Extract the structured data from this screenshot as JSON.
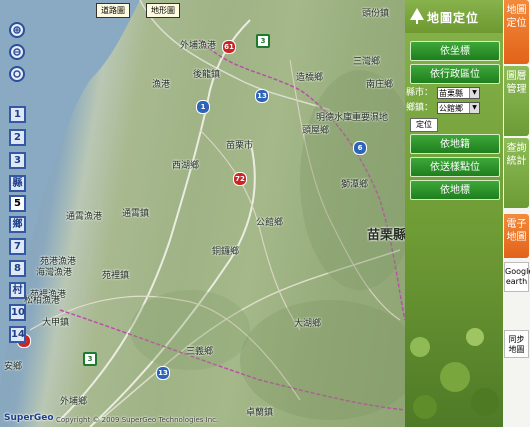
{
  "map": {
    "buttons": {
      "road_map": "道路圖",
      "terrain_map": "地形圖"
    },
    "zoom_levels": [
      "1",
      "2",
      "3",
      "縣",
      "5",
      "鄉",
      "7",
      "8",
      "村",
      "10",
      "14"
    ],
    "current_level": "5",
    "copyright": "Copyright © 2009 SuperGeo Technologies Inc.",
    "logo": "SuperGeo",
    "labels": [
      {
        "text": "頭份鎮"
      },
      {
        "text": "外埔漁港"
      },
      {
        "text": "後龍鎮"
      },
      {
        "text": "三灣鄉"
      },
      {
        "text": "造橋鄉"
      },
      {
        "text": "南庄鄉"
      },
      {
        "text": "苗栗市"
      },
      {
        "text": "頭屋鄉"
      },
      {
        "text": "明德水庫重要濕地"
      },
      {
        "text": "獅潭鄉"
      },
      {
        "text": "西湖鄉"
      },
      {
        "text": "通霄漁港"
      },
      {
        "text": "通霄鎮"
      },
      {
        "text": "公館鄉"
      },
      {
        "text": "苗栗縣"
      },
      {
        "text": "銅鑼鄉"
      },
      {
        "text": "苑港漁港"
      },
      {
        "text": "苑裡鎮"
      },
      {
        "text": "苑裡漁港"
      },
      {
        "text": "海灣漁港"
      },
      {
        "text": "松柏漁港"
      },
      {
        "text": "大甲鎮"
      },
      {
        "text": "三義鄉"
      },
      {
        "text": "大湖鄉"
      },
      {
        "text": "安鄉"
      },
      {
        "text": "外埔鄉"
      },
      {
        "text": "卓蘭鎮"
      },
      {
        "text": "漁港"
      }
    ],
    "shields": [
      {
        "num": "61",
        "color": "red"
      },
      {
        "num": "3",
        "color": "green"
      },
      {
        "num": "1",
        "color": "blue"
      },
      {
        "num": "13",
        "color": "blue"
      },
      {
        "num": "6",
        "color": "blue"
      },
      {
        "num": "72",
        "color": "red"
      },
      {
        "num": "3",
        "color": "green"
      },
      {
        "num": "13",
        "color": "blue"
      },
      {
        "num": "4",
        "color": "red"
      }
    ]
  },
  "panel": {
    "title": "地圖定位",
    "buttons": [
      "依坐標",
      "依行政區位",
      "依地籍",
      "依送樣點位",
      "依地標"
    ],
    "county_label": "縣市：",
    "county_value": "苗栗縣",
    "township_label": "鄉鎮：",
    "township_value": "公館鄉",
    "locate": "定位"
  },
  "tabs": [
    "地圖定位",
    "圖層管理",
    "查詢統計",
    "電子地圖",
    "Google earth",
    "同步地圖"
  ],
  "colors": {
    "panel_green": "#6f9b35",
    "button_green": "#1f7f1e",
    "tab_orange": "#e2631a",
    "zoom_blue": "#3458a3"
  }
}
